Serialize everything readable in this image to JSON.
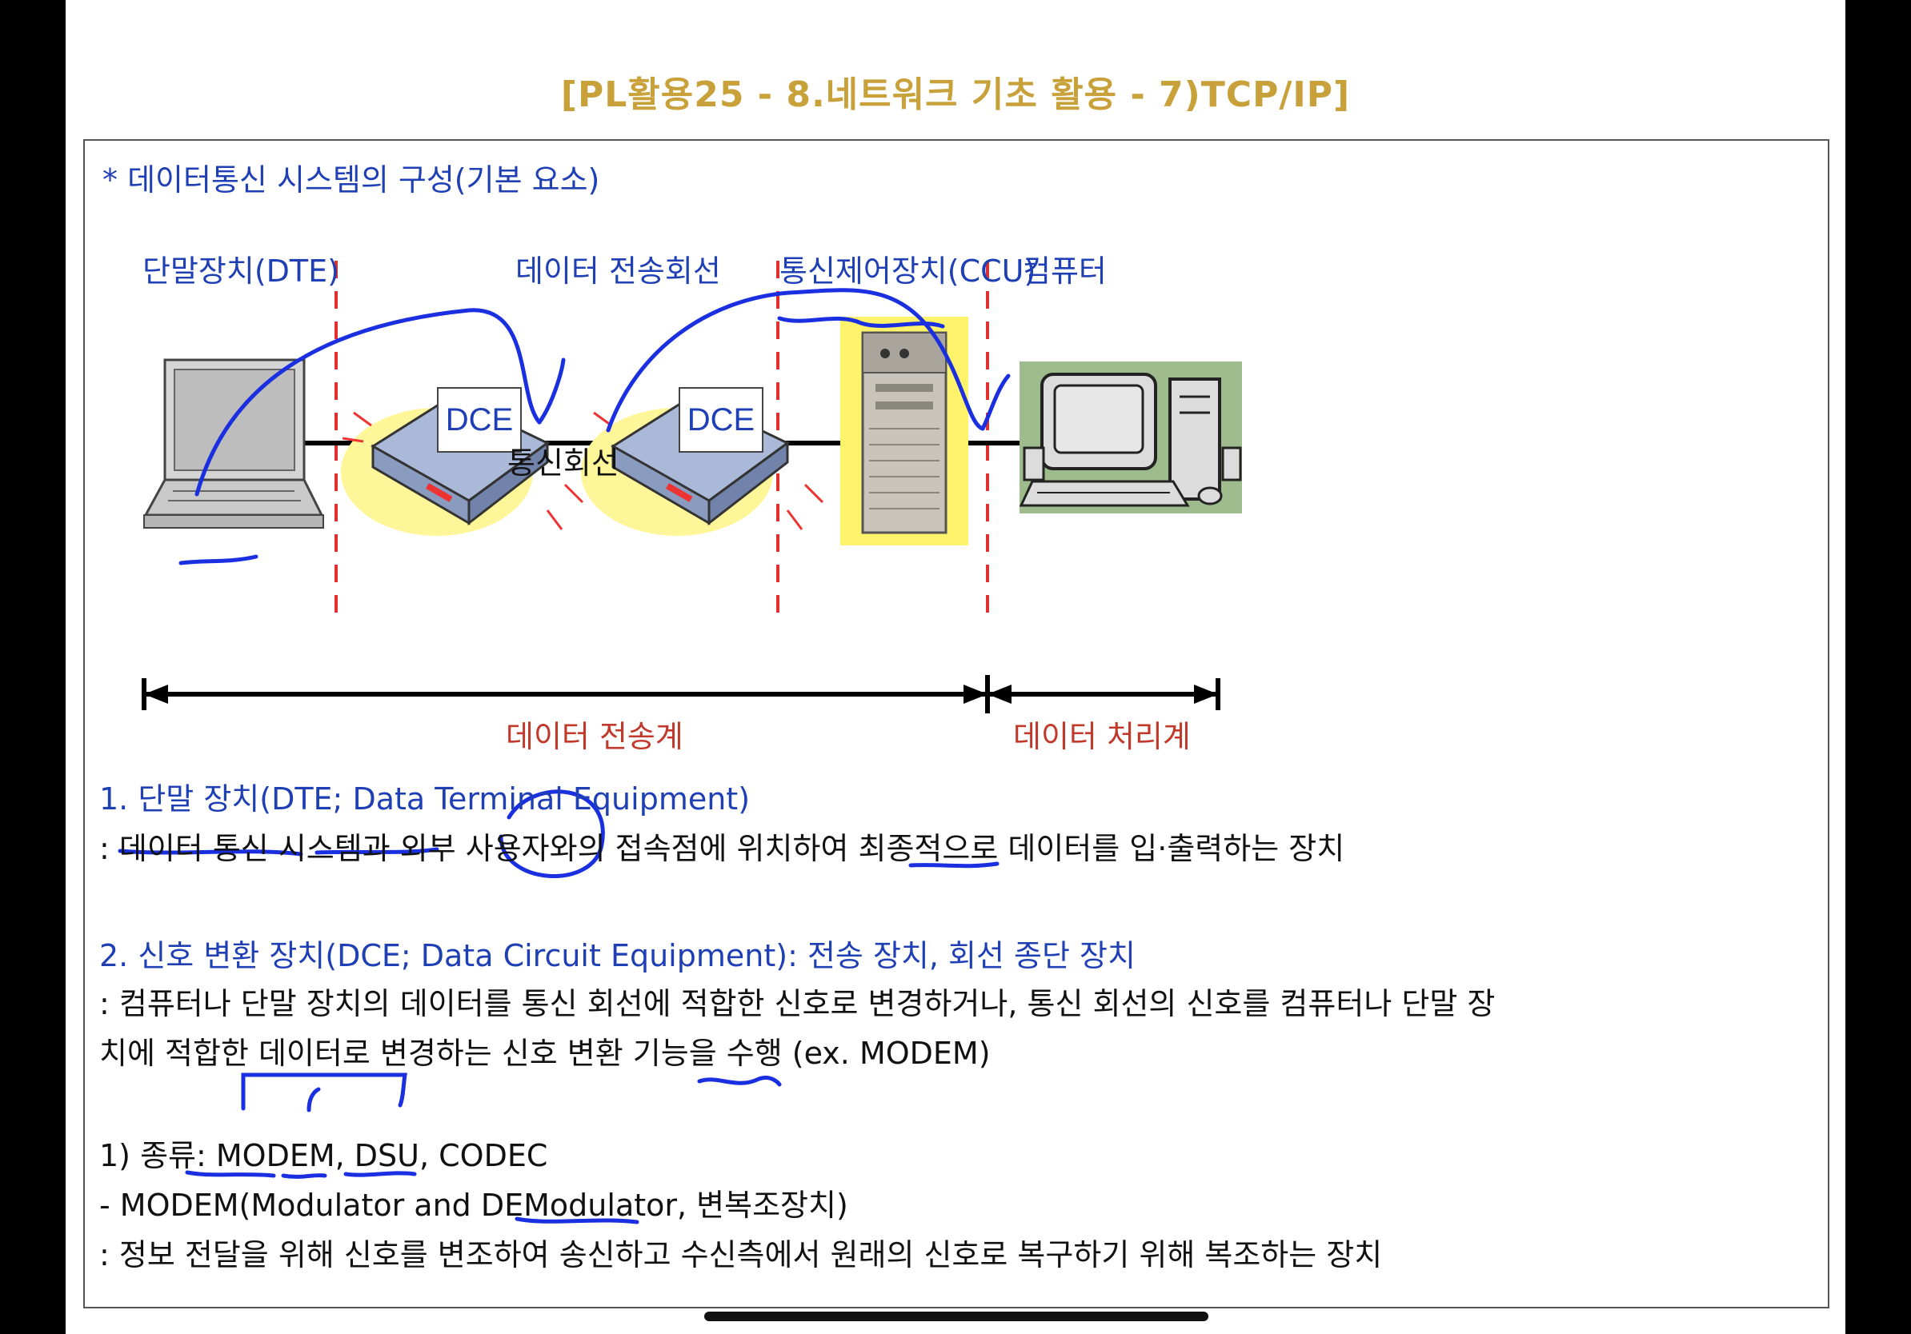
{
  "page_title": "[PL활용25 - 8.네트워크 기초 활용 - 7)TCP/IP]",
  "heading": "* 데이터통신 시스템의 구성(기본 요소)",
  "diagram": {
    "labels": {
      "dte": "단말장치(DTE)",
      "line": "데이터 전송회선",
      "ccu": "통신제어장치(CCU)",
      "computer": "컴퓨터"
    },
    "dce_left": "DCE",
    "dce_right": "DCE",
    "comm_line": "통신회선",
    "span_transmission": "데이터 전송계",
    "span_processing": "데이터 처리계"
  },
  "section1": {
    "title": "1. 단말 장치(DTE; Data Terminal Equipment)",
    "desc": ": 데이터 통신 시스템과 외부 사용자와의 접속점에 위치하여 최종적으로 데이터를 입·출력하는 장치"
  },
  "section2": {
    "title": "2. 신호 변환 장치(DCE; Data Circuit Equipment): 전송 장치, 회선 종단 장치",
    "desc_line1": ": 컴퓨터나 단말 장치의 데이터를 통신 회선에 적합한 신호로 변경하거나, 통신 회선의 신호를 컴퓨터나 단말 장",
    "desc_line2": "치에 적합한 데이터로 변경하는 신호 변환 기능을 수행 (ex. MODEM)"
  },
  "types": {
    "line1": "1) 종류: MODEM, DSU, CODEC",
    "line2": "- MODEM(Modulator and DEModulator, 변복조장치)",
    "line3": ": 정보 전달을 위해 신호를 변조하여 송신하고 수신측에서 원래의 신호로 복구하기 위해 복조하는 장치"
  },
  "colors": {
    "title": "#c9a13a",
    "blue_text": "#1f3fb4",
    "red_text": "#c0392b",
    "ink": "#1a2fe0",
    "divider": "#e03030"
  }
}
